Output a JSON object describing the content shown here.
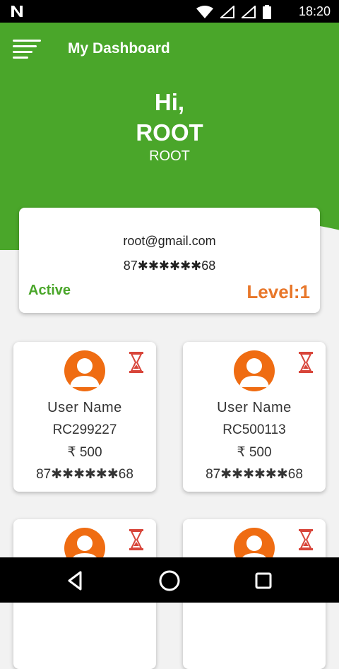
{
  "status_bar": {
    "time": "18:20",
    "icons": [
      "notification-n-icon",
      "wifi-icon",
      "signal-icon",
      "signal-icon",
      "battery-icon"
    ]
  },
  "header": {
    "title": "My Dashboard",
    "greeting": "Hi,",
    "name": "ROOT",
    "sub_name": "ROOT"
  },
  "profile": {
    "email": "root@gmail.com",
    "phone": "87✱✱✱✱✱✱68",
    "status": "Active",
    "level": "Level:1"
  },
  "members": [
    {
      "name": "User Name",
      "id": "RC299227",
      "amount": "₹ 500",
      "phone": "87✱✱✱✱✱✱68"
    },
    {
      "name": "User Name",
      "id": "RC500113",
      "amount": "₹ 500",
      "phone": "87✱✱✱✱✱✱68"
    },
    {
      "name": "",
      "id": "",
      "amount": "",
      "phone": ""
    },
    {
      "name": "",
      "id": "",
      "amount": "",
      "phone": ""
    }
  ],
  "colors": {
    "primary_green": "#4aa62a",
    "accent_orange": "#e8772a",
    "avatar_orange": "#ef6c12",
    "pending_red": "#d8453a"
  }
}
